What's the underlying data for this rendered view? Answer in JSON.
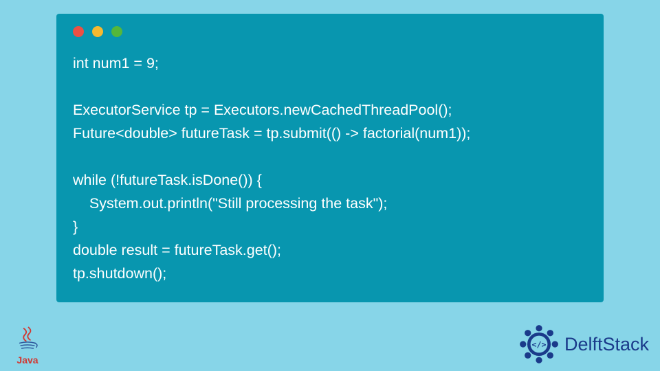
{
  "code": {
    "lines": [
      "int num1 = 9;",
      "",
      "ExecutorService tp = Executors.newCachedThreadPool();",
      "Future<double> futureTask = tp.submit(() -> factorial(num1));",
      "",
      "while (!futureTask.isDone()) {",
      "    System.out.println(\"Still processing the task\");",
      "}",
      "double result = futureTask.get();",
      "tp.shutdown();"
    ]
  },
  "logos": {
    "java_label": "Java",
    "delft_label": "DelftStack"
  },
  "colors": {
    "background": "#87d5e8",
    "window": "#0896af",
    "dot_red": "#ec5044",
    "dot_yellow": "#f7b92f",
    "dot_green": "#54b73b",
    "code_text": "#ffffff",
    "java_accent": "#d13832",
    "delft_accent": "#1a3a8a"
  }
}
